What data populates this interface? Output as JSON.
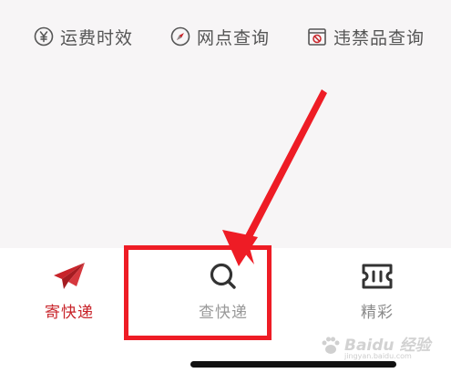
{
  "quick_links": [
    {
      "label": "运费时效",
      "icon": "yen-coin-icon"
    },
    {
      "label": "网点查询",
      "icon": "compass-icon"
    },
    {
      "label": "违禁品查询",
      "icon": "prohibited-items-icon"
    }
  ],
  "tab_bar": {
    "tabs": [
      {
        "label": "寄快递",
        "icon": "paper-plane-icon",
        "active": true
      },
      {
        "label": "查快递",
        "icon": "search-icon",
        "active": false
      },
      {
        "label": "精彩",
        "icon": "ticket-icon",
        "active": false
      }
    ]
  },
  "annotation": {
    "color": "#ee1c25",
    "highlighted_tab": "查快递"
  },
  "watermark": {
    "text": "Baidu 经验",
    "url": "jingyan.baidu.com"
  },
  "colors": {
    "brand_red": "#c8242a",
    "background": "#f7f5f6",
    "icon_gray": "#555555"
  }
}
